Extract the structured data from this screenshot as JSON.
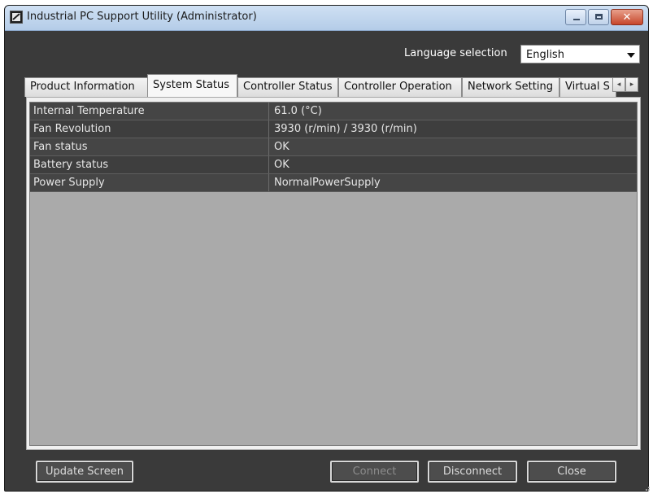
{
  "window": {
    "title": "Industrial PC Support Utility (Administrator)",
    "controls": {
      "minimize_icon": "minimize-icon",
      "maximize_icon": "maximize-icon",
      "close_icon": "close-icon",
      "close_glyph": "✕"
    }
  },
  "language": {
    "label": "Language selection",
    "selected": "English"
  },
  "tabs": [
    {
      "label": "Product Information",
      "active": false
    },
    {
      "label": "System Status",
      "active": true
    },
    {
      "label": "Controller Status",
      "active": false
    },
    {
      "label": "Controller Operation",
      "active": false
    },
    {
      "label": "Network Setting",
      "active": false
    },
    {
      "label": "Virtual S",
      "active": false
    }
  ],
  "tab_scroll": {
    "left_glyph": "◂",
    "right_glyph": "▸"
  },
  "status_table": {
    "rows": [
      {
        "name": "Internal Temperature",
        "value": "61.0 (°C)"
      },
      {
        "name": "Fan Revolution",
        "value": "3930 (r/min) / 3930 (r/min)"
      },
      {
        "name": "Fan status",
        "value": "OK"
      },
      {
        "name": "Battery status",
        "value": "OK"
      },
      {
        "name": "Power Supply",
        "value": "NormalPowerSupply"
      }
    ]
  },
  "buttons": {
    "update_screen": "Update Screen",
    "connect": "Connect",
    "disconnect": "Disconnect",
    "close": "Close"
  },
  "colors": {
    "window_bg": "#3a3a3a",
    "titlebar": "#b4cce8",
    "row_bg": "#454545",
    "row_text": "#e6e6e6",
    "empty_grid": "#aaaaaa"
  }
}
